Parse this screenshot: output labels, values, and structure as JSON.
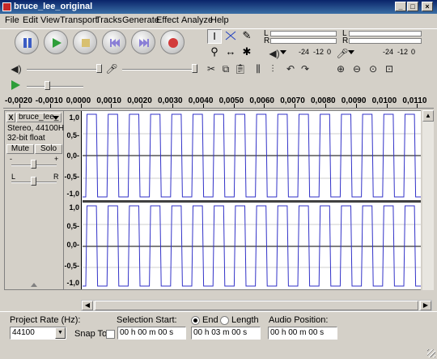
{
  "window": {
    "title": "bruce_lee_original",
    "controls": [
      "_",
      "□",
      "×"
    ]
  },
  "menu": [
    "File",
    "Edit",
    "View",
    "Transport",
    "Tracks",
    "Generate",
    "Effect",
    "Analyze",
    "Help"
  ],
  "transport": {
    "buttons": [
      "pause",
      "play",
      "stop",
      "skip-start",
      "skip-end",
      "record"
    ]
  },
  "meters": {
    "playback_channels": [
      "L",
      "R"
    ],
    "record_channels": [
      "L",
      "R"
    ],
    "scale_left": [
      "-24",
      "-12",
      "0"
    ],
    "scale_right": [
      "-24",
      "-12",
      "0"
    ]
  },
  "ruler": {
    "labels": [
      "-0,0020",
      "-0,0010",
      "0,0000",
      "0,0010",
      "0,0020",
      "0,0030",
      "0,0040",
      "0,0050",
      "0,0060",
      "0,0070",
      "0,0080",
      "0,0090",
      "0,0100",
      "0,0110"
    ]
  },
  "track": {
    "name": "bruce_lee_",
    "close": "X",
    "info_line1": "Stereo, 44100Hz",
    "info_line2": "32-bit float",
    "mute": "Mute",
    "solo": "Solo",
    "gain_minus": "-",
    "gain_plus": "+",
    "pan_left": "L",
    "pan_right": "R",
    "vruler_top": [
      "1,0",
      "0,5-",
      "0,0-",
      "-0,5-",
      "-1,0"
    ],
    "vruler_bottom": [
      "1,0",
      "0,5-",
      "0,0-",
      "-0,5-",
      "-1,0"
    ]
  },
  "status": {
    "project_rate_label": "Project Rate (Hz):",
    "project_rate_value": "44100",
    "selection_start_label": "Selection Start:",
    "end_label": "End",
    "length_label": "Length",
    "snap_to_label": "Snap To",
    "selection_start_value": "00 h 00 m 00 s",
    "end_value": "00 h 03 m 00 s",
    "audio_position_label": "Audio Position:",
    "audio_position_value": "00 h 00 m 00 s"
  }
}
